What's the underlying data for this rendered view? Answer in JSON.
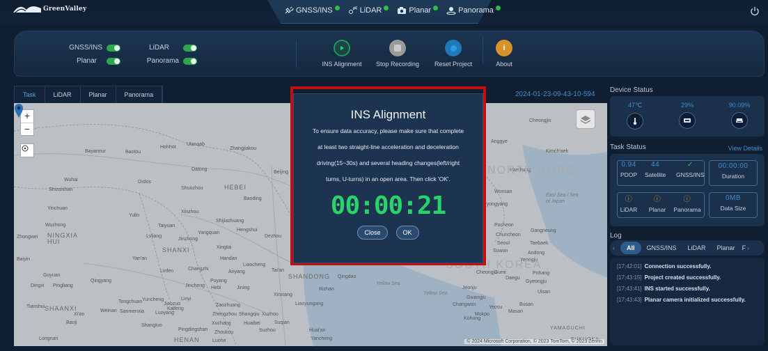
{
  "app": {
    "logo_text": "GreenValley"
  },
  "header": {
    "sensors": [
      {
        "label": "GNSS/INS",
        "status_color": "#2fbf49"
      },
      {
        "label": "LiDAR",
        "status_color": "#2fbf49"
      },
      {
        "label": "Planar",
        "status_color": "#2fbf49"
      },
      {
        "label": "Panorama",
        "status_color": "#2fbf49"
      }
    ],
    "power_icon": "power-icon"
  },
  "controls": {
    "toggles": [
      {
        "label": "GNSS/INS",
        "on": true
      },
      {
        "label": "LiDAR",
        "on": true
      },
      {
        "label": "Planar",
        "on": true
      },
      {
        "label": "Panorama",
        "on": true
      }
    ],
    "actions": [
      {
        "label": "INS Alignment",
        "color": "#1e9a4a"
      },
      {
        "label": "Stop Recording",
        "color": "#8f8f8f"
      },
      {
        "label": "Reset Project",
        "color": "#1f78b8"
      },
      {
        "label": "About",
        "color": "#d8922a"
      }
    ]
  },
  "map_panel": {
    "tabs": [
      "Task",
      "LiDAR",
      "Planar",
      "Panorama"
    ],
    "active_tab": "Task",
    "timestamp": "2024-01-23-09-43-10-594",
    "zoom_in": "+",
    "zoom_out": "−",
    "places": [
      "Bayannur",
      "Baotou",
      "Hohhot",
      "Ulanqab",
      "Zhangjiakou",
      "Datong",
      "Beijing",
      "Wuhai",
      "Ordos",
      "Shuozhou",
      "HEBEI",
      "Shizuishan",
      "Baoding",
      "Yinchuan",
      "Yulin",
      "Xinzhou",
      "Wuzhong",
      "Taiyuan",
      "Shijiazhuang",
      "Hengshui",
      "Zhongwei",
      "NINGXIA HUI",
      "Lvliang",
      "Jinzhong",
      "Yangquan",
      "Dezhou",
      "SHANXI",
      "Xingtai",
      "Baiyin",
      "Yan'an",
      "Handan",
      "Liaocheng",
      "Linfen",
      "Changzhi",
      "Anyang",
      "Tai'an",
      "Guyuan",
      "Qingyang",
      "Jincheng",
      "Puyang",
      "SHANDONG",
      "Qingdao",
      "Dingxi",
      "Pingliang",
      "Hebi",
      "Jining",
      "Rizhao",
      "Tongchuan",
      "Yuncheng",
      "Jiaozuo",
      "Xinxiang",
      "Linyi",
      "Tianshui",
      "SHAANXI",
      "Weinan",
      "Sanmenxia",
      "Luoyang",
      "Kaifeng",
      "Zaozhuang",
      "Lianyungang",
      "Xi'an",
      "Baoji",
      "Zhengzhou",
      "Shangqiu",
      "Xuzhou",
      "Shangluo",
      "Pingdingshan",
      "Xuchang",
      "Huaibei",
      "Suqian",
      "Zhoukou",
      "Suzhou",
      "Huai'an",
      "Longnan",
      "HENAN",
      "Luohe",
      "Yancheng",
      "Cheongjin",
      "Anggye",
      "Kimch'aek",
      "Hamhung",
      "NORTH KOREA",
      "Wonsan",
      "Pyongyang",
      "Pocheon",
      "Chuncheon",
      "Gangneung",
      "Seoul",
      "Taebaek",
      "Suwon",
      "Yeongju",
      "Andong",
      "SOUTH KOREA",
      "Cheongju",
      "Gumi",
      "Daegu",
      "Gyeongju",
      "Pohang",
      "Jeonju",
      "Ulsan",
      "Gwangju",
      "Busan",
      "Changwon",
      "Mokpo",
      "Yeosu",
      "Masan",
      "Kohung",
      "YAMAGUCHI",
      "FUKUOKA"
    ],
    "seas": [
      "East Sea / Sea of Japan",
      "Yellow Sea",
      "Yellow Sea"
    ],
    "copyright": "© 2024 Microsoft Corporation, © 2023 TomTom, © 2023 Zenrin"
  },
  "device_status": {
    "title": "Device Status",
    "items": [
      {
        "value": "47℃",
        "icon": "thermometer-icon"
      },
      {
        "value": "29%",
        "icon": "storage-icon"
      },
      {
        "value": "90.09%",
        "icon": "disk-icon"
      }
    ]
  },
  "task_status": {
    "title": "Task Status",
    "link": "View Details",
    "group1": [
      {
        "value": "0.94",
        "label": "PDOP"
      },
      {
        "value": "44",
        "label": "Satellite"
      },
      {
        "value": "✓",
        "label": "GNSS/INS"
      }
    ],
    "duration": {
      "value": "00:00:00",
      "label": "Duration"
    },
    "group2": [
      {
        "value": "ⓘ",
        "label": "LiDAR"
      },
      {
        "value": "ⓘ",
        "label": "Planar"
      },
      {
        "value": "ⓘ",
        "label": "Panorama"
      }
    ],
    "data_size": {
      "value": "0MB",
      "label": "Data Size"
    }
  },
  "log": {
    "title": "Log",
    "tabs": [
      "All",
      "GNSS/INS",
      "LiDAR",
      "Planar",
      "F"
    ],
    "active_tab": "All",
    "entries": [
      {
        "time": "[17:42:01]",
        "msg": "Connection successfully."
      },
      {
        "time": "[17:43:15]",
        "msg": "Project created successfully."
      },
      {
        "time": "[17:43:41]",
        "msg": "INS started successfully."
      },
      {
        "time": "[17:43:43]",
        "msg": "Planar camera initialized successfully."
      }
    ]
  },
  "modal": {
    "title": "INS Alignment",
    "lines": [
      "To ensure data accuracy, please make sure that complete",
      "at least two straight-line acceleration and deceleration",
      "driving(15~30s) and several heading changes(left/right",
      "turns, U-turns) in an open area. Then click 'OK'."
    ],
    "timer": "00:00:21",
    "close_label": "Close",
    "ok_label": "OK",
    "highlight_color": "#c40f12"
  }
}
